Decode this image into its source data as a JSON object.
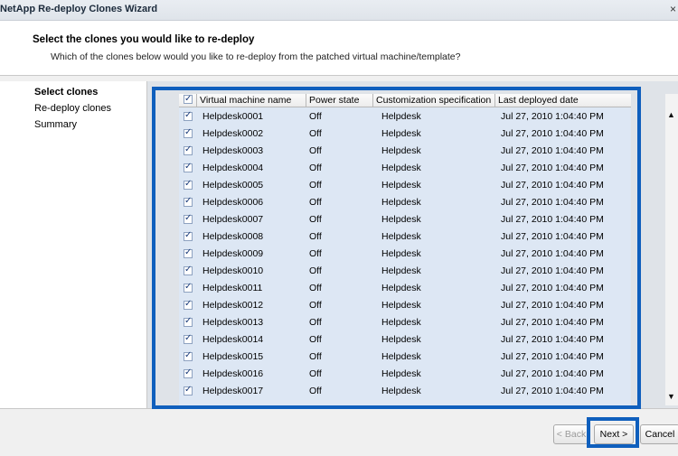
{
  "window": {
    "title": "NetApp Re-deploy Clones Wizard",
    "close_glyph": "×"
  },
  "header": {
    "title": "Select the clones you would like to re-deploy",
    "subtitle": "Which of the clones below would you like to re-deploy from the patched virtual machine/template?"
  },
  "steps": [
    {
      "label": "Select clones",
      "active": true
    },
    {
      "label": "Re-deploy clones",
      "active": false
    },
    {
      "label": "Summary",
      "active": false
    }
  ],
  "table": {
    "columns": [
      "Virtual machine name",
      "Power state",
      "Customization specification",
      "Last deployed date"
    ],
    "rows": [
      {
        "checked": true,
        "name": "Helpdesk0001",
        "power": "Off",
        "spec": "Helpdesk",
        "date": "Jul 27, 2010 1:04:40 PM"
      },
      {
        "checked": true,
        "name": "Helpdesk0002",
        "power": "Off",
        "spec": "Helpdesk",
        "date": "Jul 27, 2010 1:04:40 PM"
      },
      {
        "checked": true,
        "name": "Helpdesk0003",
        "power": "Off",
        "spec": "Helpdesk",
        "date": "Jul 27, 2010 1:04:40 PM"
      },
      {
        "checked": true,
        "name": "Helpdesk0004",
        "power": "Off",
        "spec": "Helpdesk",
        "date": "Jul 27, 2010 1:04:40 PM"
      },
      {
        "checked": true,
        "name": "Helpdesk0005",
        "power": "Off",
        "spec": "Helpdesk",
        "date": "Jul 27, 2010 1:04:40 PM"
      },
      {
        "checked": true,
        "name": "Helpdesk0006",
        "power": "Off",
        "spec": "Helpdesk",
        "date": "Jul 27, 2010 1:04:40 PM"
      },
      {
        "checked": true,
        "name": "Helpdesk0007",
        "power": "Off",
        "spec": "Helpdesk",
        "date": "Jul 27, 2010 1:04:40 PM"
      },
      {
        "checked": true,
        "name": "Helpdesk0008",
        "power": "Off",
        "spec": "Helpdesk",
        "date": "Jul 27, 2010 1:04:40 PM"
      },
      {
        "checked": true,
        "name": "Helpdesk0009",
        "power": "Off",
        "spec": "Helpdesk",
        "date": "Jul 27, 2010 1:04:40 PM"
      },
      {
        "checked": true,
        "name": "Helpdesk0010",
        "power": "Off",
        "spec": "Helpdesk",
        "date": "Jul 27, 2010 1:04:40 PM"
      },
      {
        "checked": true,
        "name": "Helpdesk0011",
        "power": "Off",
        "spec": "Helpdesk",
        "date": "Jul 27, 2010 1:04:40 PM"
      },
      {
        "checked": true,
        "name": "Helpdesk0012",
        "power": "Off",
        "spec": "Helpdesk",
        "date": "Jul 27, 2010 1:04:40 PM"
      },
      {
        "checked": true,
        "name": "Helpdesk0013",
        "power": "Off",
        "spec": "Helpdesk",
        "date": "Jul 27, 2010 1:04:40 PM"
      },
      {
        "checked": true,
        "name": "Helpdesk0014",
        "power": "Off",
        "spec": "Helpdesk",
        "date": "Jul 27, 2010 1:04:40 PM"
      },
      {
        "checked": true,
        "name": "Helpdesk0015",
        "power": "Off",
        "spec": "Helpdesk",
        "date": "Jul 27, 2010 1:04:40 PM"
      },
      {
        "checked": true,
        "name": "Helpdesk0016",
        "power": "Off",
        "spec": "Helpdesk",
        "date": "Jul 27, 2010 1:04:40 PM"
      },
      {
        "checked": true,
        "name": "Helpdesk0017",
        "power": "Off",
        "spec": "Helpdesk",
        "date": "Jul 27, 2010 1:04:40 PM"
      }
    ]
  },
  "footer": {
    "back_label": "< Back",
    "next_label": "Next >",
    "cancel_label": "Cancel"
  },
  "colors": {
    "highlight": "#0f5fbd",
    "row_bg": "#dde7f4"
  }
}
